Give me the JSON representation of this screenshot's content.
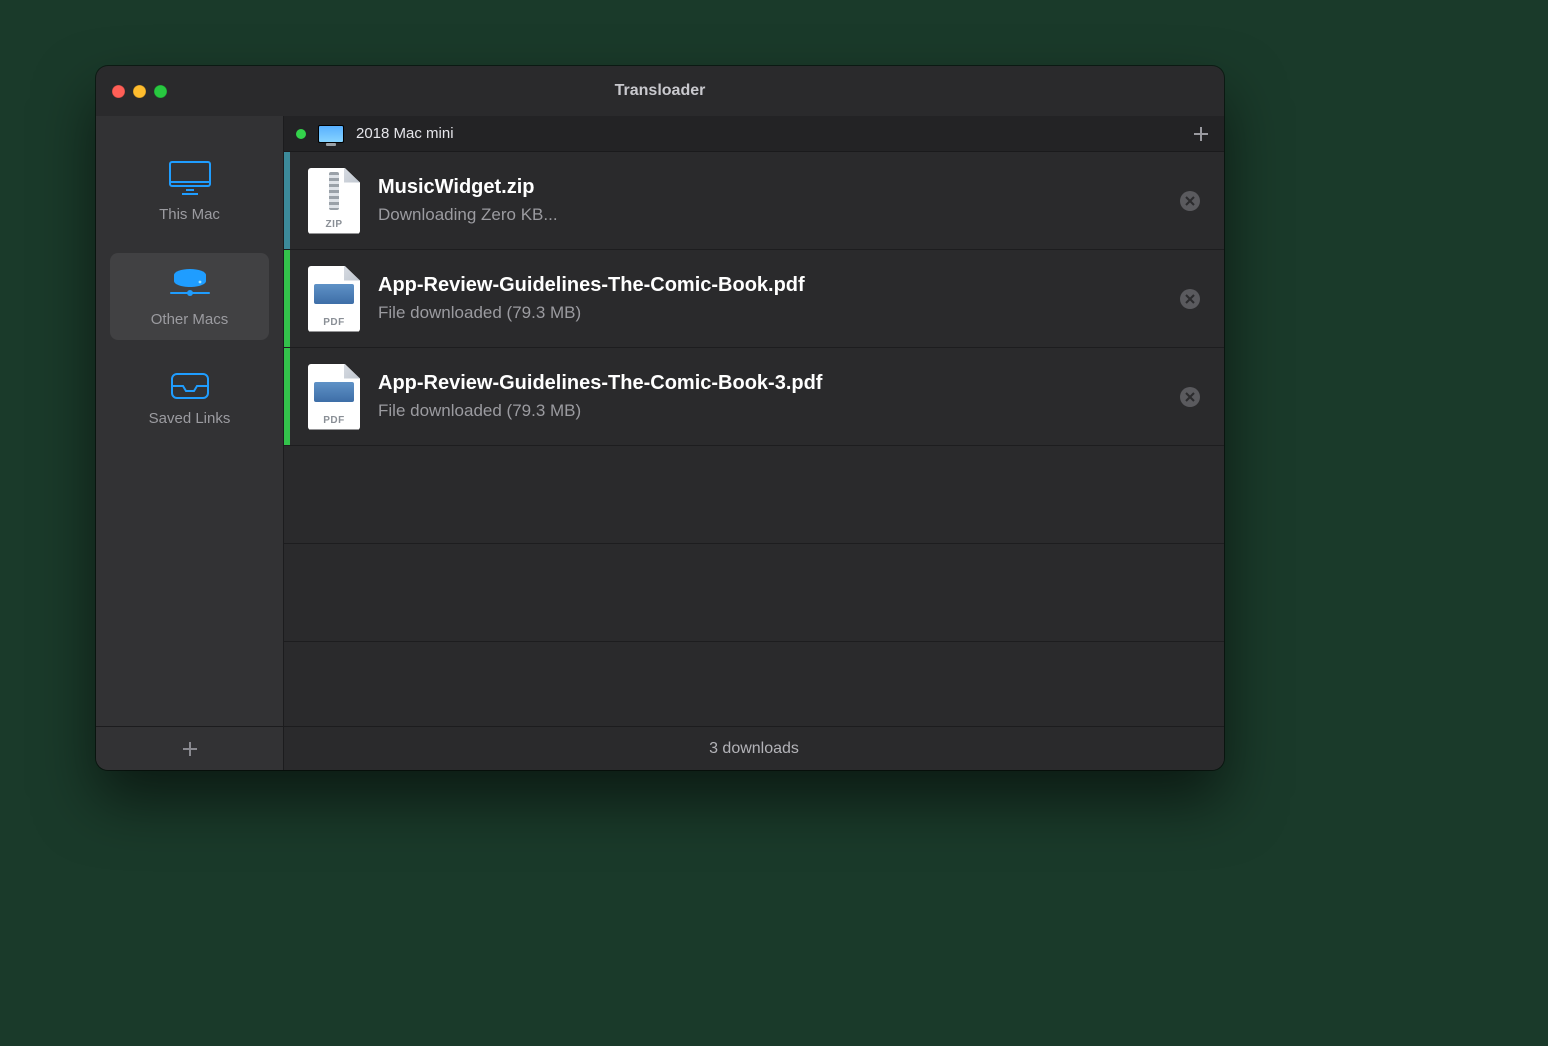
{
  "window": {
    "title": "Transloader"
  },
  "sidebar": {
    "items": [
      {
        "label": "This Mac"
      },
      {
        "label": "Other Macs"
      },
      {
        "label": "Saved Links"
      }
    ]
  },
  "device": {
    "name": "2018 Mac mini"
  },
  "downloads": [
    {
      "name": "MusicWidget.zip",
      "status": "Downloading Zero KB...",
      "ext": "ZIP",
      "kind": "zip",
      "state": "active"
    },
    {
      "name": "App-Review-Guidelines-The-Comic-Book.pdf",
      "status": "File downloaded (79.3 MB)",
      "ext": "PDF",
      "kind": "pdf",
      "state": "done"
    },
    {
      "name": "App-Review-Guidelines-The-Comic-Book-3.pdf",
      "status": "File downloaded (79.3 MB)",
      "ext": "PDF",
      "kind": "pdf",
      "state": "done"
    }
  ],
  "statusbar": {
    "text": "3 downloads"
  }
}
